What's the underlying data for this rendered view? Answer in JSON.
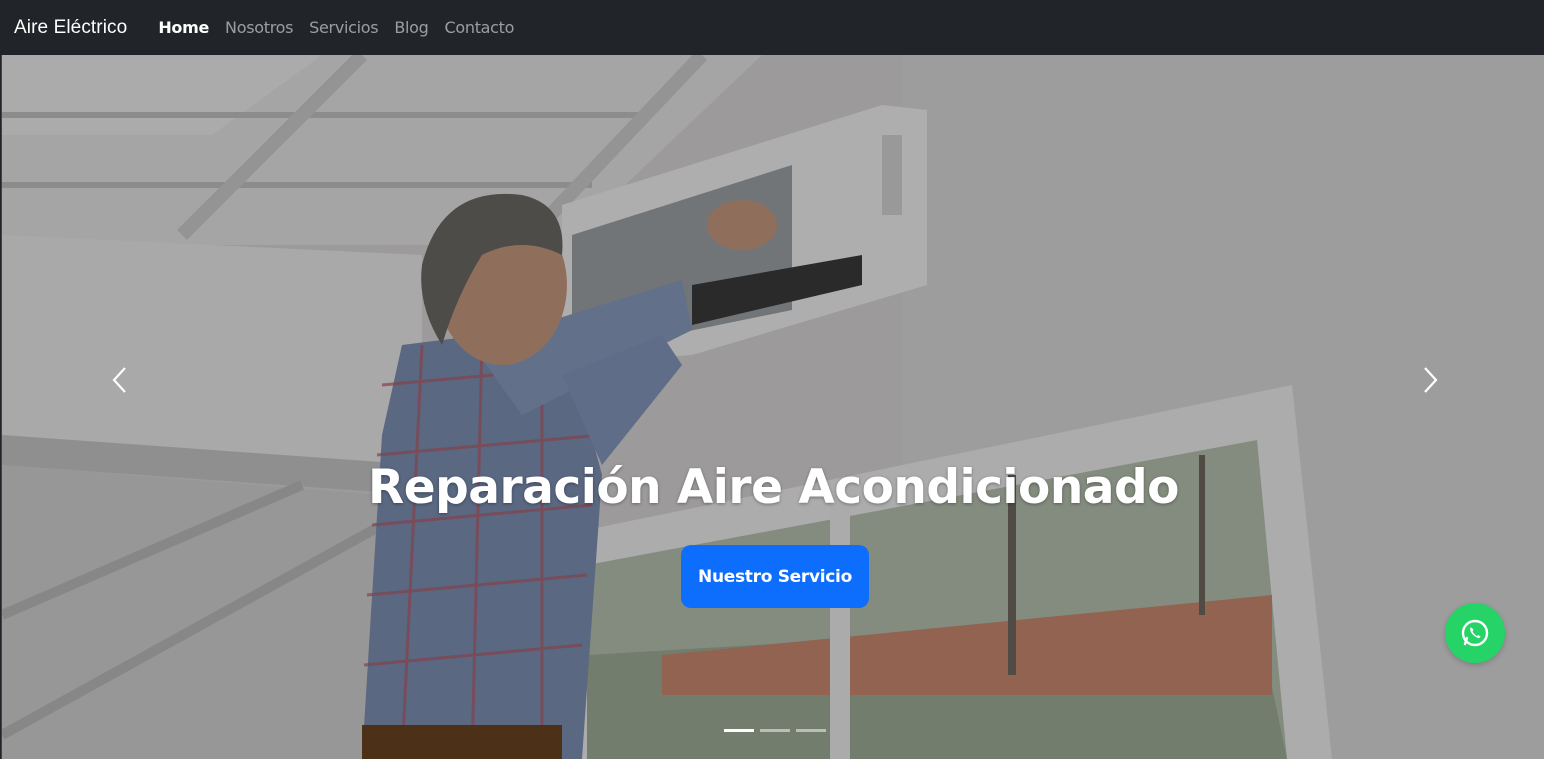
{
  "navbar": {
    "brand": "Aire Eléctrico",
    "links": [
      {
        "label": "Home",
        "active": true
      },
      {
        "label": "Nosotros",
        "active": false
      },
      {
        "label": "Servicios",
        "active": false
      },
      {
        "label": "Blog",
        "active": false
      },
      {
        "label": "Contacto",
        "active": false
      }
    ]
  },
  "hero": {
    "title": "Reparación Aire Acondicionado",
    "button_label": "Nuestro Servicio",
    "slides_count": 3,
    "active_slide": 1,
    "prev_icon": "chevron-left-icon",
    "next_icon": "chevron-right-icon"
  },
  "floating": {
    "whatsapp_icon": "whatsapp-icon",
    "whatsapp_color": "#25d366"
  },
  "colors": {
    "navbar_bg": "#212529",
    "primary": "#0d6efd"
  }
}
